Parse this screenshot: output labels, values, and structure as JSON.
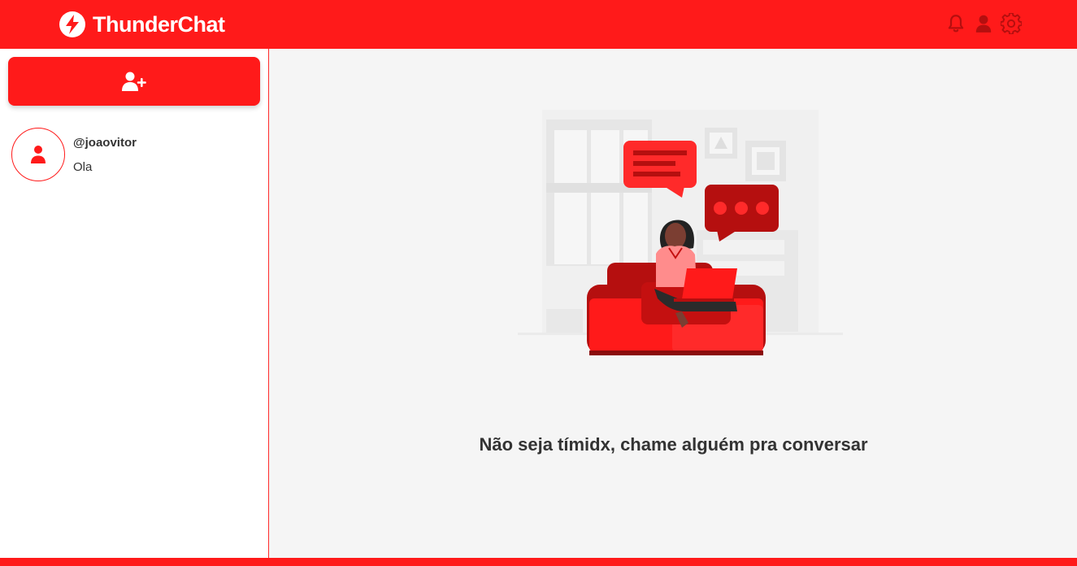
{
  "header": {
    "app_name": "ThunderChat",
    "icons": [
      "lightning-logo-icon",
      "bell-icon",
      "user-icon",
      "gear-icon"
    ]
  },
  "sidebar": {
    "add_contact_icon": "user-plus-icon",
    "contacts": [
      {
        "username": "@joaovitor",
        "last_message": "Ola"
      }
    ]
  },
  "main": {
    "empty_state_text": "Não seja tímidx, chame alguém pra conversar"
  },
  "colors": {
    "accent": "#ff1a1a",
    "dark_red": "#b50f0f",
    "background": "#f5f5f5",
    "text": "#333333"
  }
}
